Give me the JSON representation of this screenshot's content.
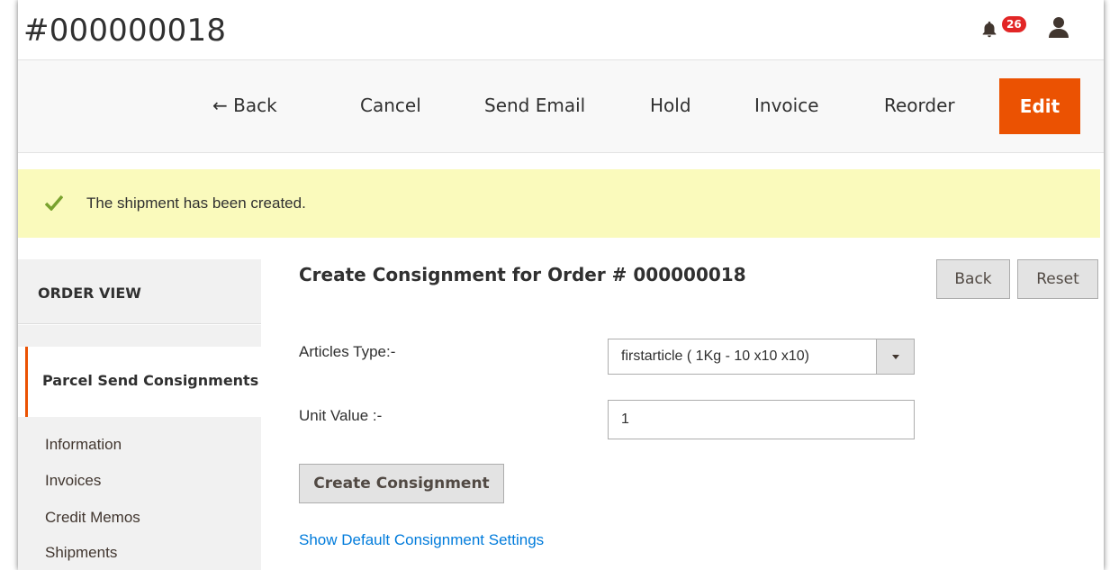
{
  "header": {
    "title": "#000000018",
    "notifications_count": "26"
  },
  "actions": {
    "back": "← Back",
    "cancel": "Cancel",
    "send_email": "Send Email",
    "hold": "Hold",
    "invoice": "Invoice",
    "reorder": "Reorder",
    "edit": "Edit"
  },
  "message": {
    "text": "The shipment has been created."
  },
  "sidebar": {
    "heading": "ORDER VIEW",
    "active_tab": "Parcel Send Consignments",
    "items": [
      "Information",
      "Invoices",
      "Credit Memos",
      "Shipments"
    ]
  },
  "main": {
    "title": "Create Consignment for Order # 000000018",
    "back_button": "Back",
    "reset_button": "Reset",
    "articles_label": "Articles Type:-",
    "articles_value": "firstarticle ( 1Kg - 10 x10 x10)",
    "unit_label": "Unit Value :-",
    "unit_value": "1",
    "create_button": "Create Consignment",
    "settings_link": "Show Default Consignment Settings"
  },
  "colors": {
    "accent": "#eb5202",
    "message_bg": "#fafabc",
    "check": "#79a22e",
    "link": "#007bdb",
    "badge": "#e22626"
  }
}
